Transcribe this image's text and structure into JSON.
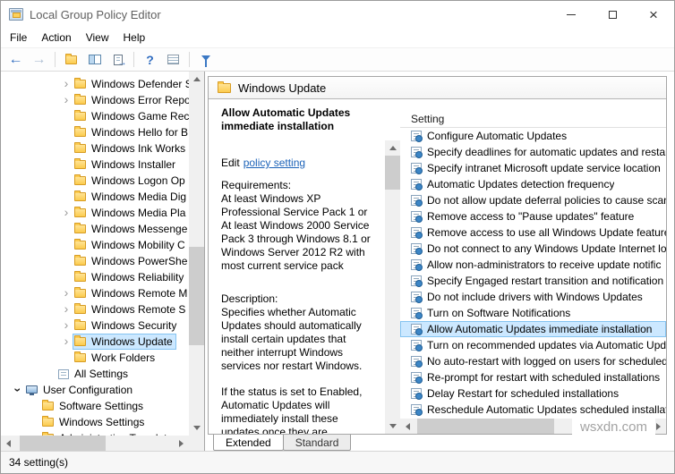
{
  "window": {
    "title": "Local Group Policy Editor"
  },
  "menu": {
    "items": [
      "File",
      "Action",
      "View",
      "Help"
    ]
  },
  "toolbar": {
    "buttons": [
      "back",
      "forward",
      "up-one-level",
      "show-console-tree",
      "export-list",
      "help",
      "icon-view",
      "filter"
    ]
  },
  "tree": {
    "items": [
      {
        "label": "Windows Defender S",
        "level": 3,
        "chevron": "collapsed",
        "icon": "folder",
        "selected": false
      },
      {
        "label": "Windows Error Repo",
        "level": 3,
        "chevron": "collapsed",
        "icon": "folder",
        "selected": false
      },
      {
        "label": "Windows Game Rec",
        "level": 3,
        "chevron": "none",
        "icon": "folder",
        "selected": false
      },
      {
        "label": "Windows Hello for B",
        "level": 3,
        "chevron": "none",
        "icon": "folder",
        "selected": false
      },
      {
        "label": "Windows Ink Works",
        "level": 3,
        "chevron": "none",
        "icon": "folder",
        "selected": false
      },
      {
        "label": "Windows Installer",
        "level": 3,
        "chevron": "none",
        "icon": "folder",
        "selected": false
      },
      {
        "label": "Windows Logon Op",
        "level": 3,
        "chevron": "none",
        "icon": "folder",
        "selected": false
      },
      {
        "label": "Windows Media Dig",
        "level": 3,
        "chevron": "none",
        "icon": "folder",
        "selected": false
      },
      {
        "label": "Windows Media Pla",
        "level": 3,
        "chevron": "collapsed",
        "icon": "folder",
        "selected": false
      },
      {
        "label": "Windows Messenge",
        "level": 3,
        "chevron": "none",
        "icon": "folder",
        "selected": false
      },
      {
        "label": "Windows Mobility C",
        "level": 3,
        "chevron": "none",
        "icon": "folder",
        "selected": false
      },
      {
        "label": "Windows PowerShe",
        "level": 3,
        "chevron": "none",
        "icon": "folder",
        "selected": false
      },
      {
        "label": "Windows Reliability",
        "level": 3,
        "chevron": "none",
        "icon": "folder",
        "selected": false
      },
      {
        "label": "Windows Remote M",
        "level": 3,
        "chevron": "collapsed",
        "icon": "folder",
        "selected": false
      },
      {
        "label": "Windows Remote S",
        "level": 3,
        "chevron": "collapsed",
        "icon": "folder",
        "selected": false
      },
      {
        "label": "Windows Security",
        "level": 3,
        "chevron": "collapsed",
        "icon": "folder",
        "selected": false
      },
      {
        "label": "Windows Update",
        "level": 3,
        "chevron": "collapsed",
        "icon": "folder",
        "selected": true
      },
      {
        "label": "Work Folders",
        "level": 3,
        "chevron": "none",
        "icon": "folder",
        "selected": false
      },
      {
        "label": "All Settings",
        "level": 2,
        "chevron": "none",
        "icon": "settings-list",
        "selected": false
      },
      {
        "label": "User Configuration",
        "level": 0,
        "chevron": "expanded",
        "icon": "computer",
        "selected": false
      },
      {
        "label": "Software Settings",
        "level": 1,
        "chevron": "none",
        "icon": "folder",
        "selected": false
      },
      {
        "label": "Windows Settings",
        "level": 1,
        "chevron": "none",
        "icon": "folder",
        "selected": false
      },
      {
        "label": "Administrative Templates",
        "level": 1,
        "chevron": "collapsed",
        "icon": "folder",
        "selected": false
      }
    ]
  },
  "content_header": {
    "title": "Windows Update"
  },
  "details_pane": {
    "policy_title": "Allow Automatic Updates immediate installation",
    "edit_prefix": "Edit",
    "edit_link": "policy setting",
    "requirements_label": "Requirements:",
    "requirements_text": "At least Windows XP Professional Service Pack 1 or At least Windows 2000 Service Pack 3 through Windows 8.1 or Windows Server 2012 R2 with most current service pack",
    "description_label": "Description:",
    "description_paragraphs": [
      "Specifies whether Automatic Updates should automatically install certain updates that neither interrupt Windows services nor restart Windows.",
      "If the status is set to Enabled, Automatic Updates will immediately install these updates once they are downloaded and ready to install"
    ]
  },
  "settings_pane": {
    "column_header": "Setting",
    "items": [
      {
        "label": "Configure Automatic Updates",
        "selected": false
      },
      {
        "label": "Specify deadlines for automatic updates and restart",
        "selected": false
      },
      {
        "label": "Specify intranet Microsoft update service location",
        "selected": false
      },
      {
        "label": "Automatic Updates detection frequency",
        "selected": false
      },
      {
        "label": "Do not allow update deferral policies to cause scan",
        "selected": false
      },
      {
        "label": "Remove access to \"Pause updates\" feature",
        "selected": false
      },
      {
        "label": "Remove access to use all Windows Update features",
        "selected": false
      },
      {
        "label": "Do not connect to any Windows Update Internet lo",
        "selected": false
      },
      {
        "label": "Allow non-administrators to receive update notific",
        "selected": false
      },
      {
        "label": "Specify Engaged restart transition and notification s",
        "selected": false
      },
      {
        "label": "Do not include drivers with Windows Updates",
        "selected": false
      },
      {
        "label": "Turn on Software Notifications",
        "selected": false
      },
      {
        "label": "Allow Automatic Updates immediate installation",
        "selected": true
      },
      {
        "label": "Turn on recommended updates via Automatic Upd",
        "selected": false
      },
      {
        "label": "No auto-restart with logged on users for scheduled",
        "selected": false
      },
      {
        "label": "Re-prompt for restart with scheduled installations",
        "selected": false
      },
      {
        "label": "Delay Restart for scheduled installations",
        "selected": false
      },
      {
        "label": "Reschedule Automatic Updates scheduled installati",
        "selected": false
      }
    ]
  },
  "tabs": {
    "items": [
      {
        "label": "Extended",
        "active": true
      },
      {
        "label": "Standard",
        "active": false
      }
    ]
  },
  "status_bar": {
    "text": "34 setting(s)"
  },
  "watermark": {
    "text": "wsxdn.com"
  },
  "colors": {
    "selection_bg": "#cce8ff",
    "selection_border": "#84c3f1",
    "link": "#1b62b8",
    "folder": "#fccb4e"
  }
}
